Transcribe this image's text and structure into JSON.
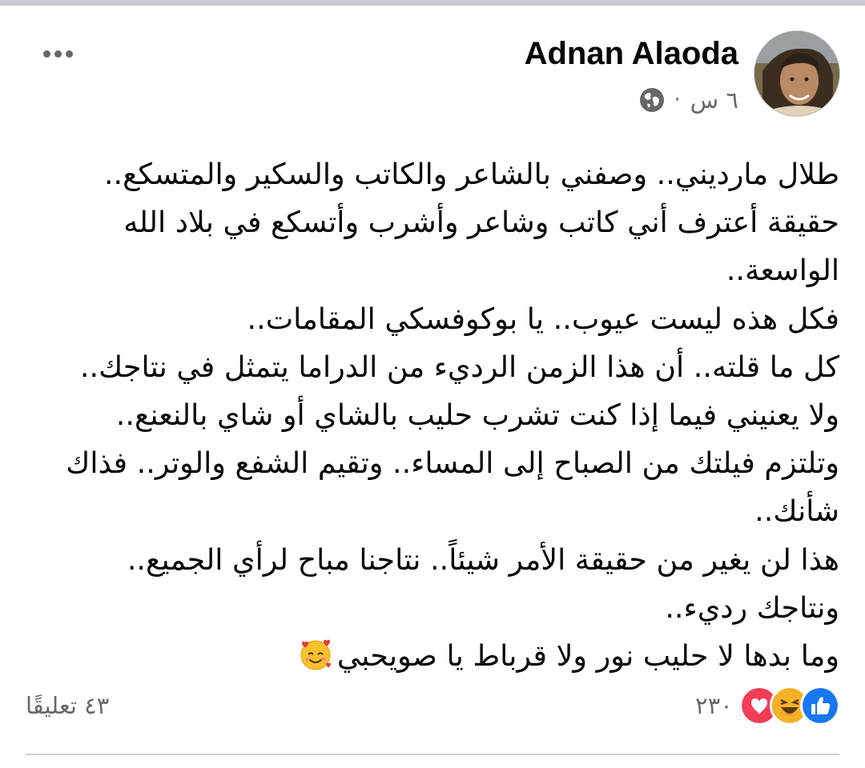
{
  "post": {
    "author": "Adnan Alaoda",
    "time": "٦ س",
    "separator": "·",
    "privacy_icon": "globe-icon",
    "more_icon": "more-dots-icon",
    "lines": [
      "طلال مارديني.. وصفني بالشاعر والكاتب والسكير والمتسكع..",
      "حقيقة أعترف أني كاتب وشاعر وأشرب وأتسكع في بلاد الله",
      "الواسعة..",
      "فكل هذه ليست عيوب.. يا بوكوفسكي المقامات..",
      "كل ما قلته.. أن هذا الزمن الرديء من الدراما يتمثل في نتاجك..",
      "ولا يعنيني فيما إذا كنت تشرب حليب بالشاي أو شاي بالنعنع..",
      "وتلتزم فيلتك من الصباح إلى المساء.. وتقيم الشفع والوتر.. فذاك",
      "شأنك..",
      "هذا لن يغير من حقيقة الأمر شيئاً.. نتاجنا مباح لرأي الجميع..",
      "ونتاجك رديء..",
      "وما بدها لا حليب نور ولا قرباط يا صويحبي"
    ],
    "last_line_emoji": "smiling-face-with-hearts-emoji"
  },
  "footer": {
    "reaction_count": "٢٣٠",
    "reaction_icons": [
      "like-icon",
      "haha-icon",
      "love-icon"
    ],
    "comments": "٤٣ تعليقًا"
  },
  "colors": {
    "like": "#1877f2",
    "love": "#f33e58",
    "haha": "#f7b125",
    "secondary_text": "#65676b",
    "divider": "#ced0d4"
  }
}
